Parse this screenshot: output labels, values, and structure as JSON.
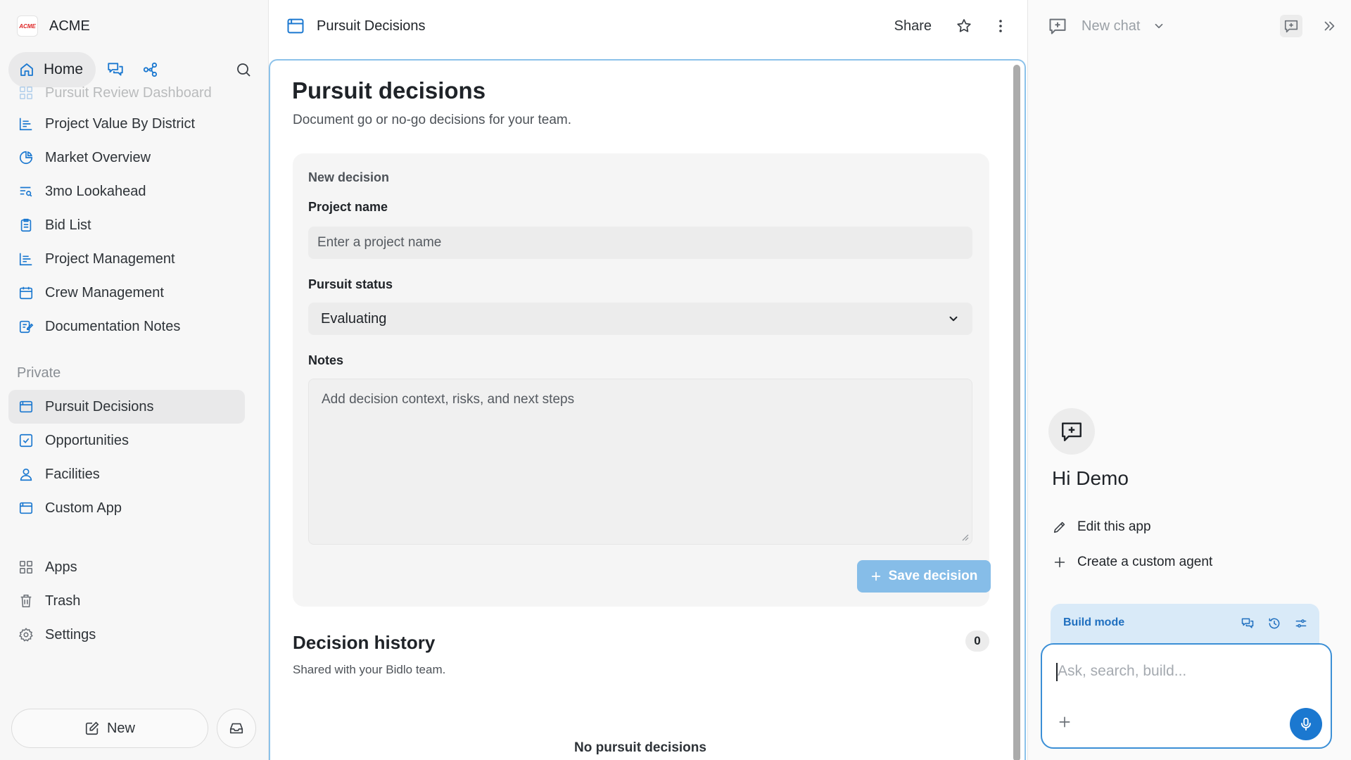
{
  "sidebar": {
    "brand": {
      "logo_text": "ACME",
      "name": "ACME"
    },
    "home_label": "Home",
    "items": [
      {
        "label": "Pursuit Review Dashboard",
        "icon": "dashboard-icon"
      },
      {
        "label": "Project Value By District",
        "icon": "bar-chart-icon"
      },
      {
        "label": "Market Overview",
        "icon": "pie-chart-icon"
      },
      {
        "label": "3mo Lookahead",
        "icon": "list-search-icon"
      },
      {
        "label": "Bid List",
        "icon": "clipboard-icon"
      },
      {
        "label": "Project Management",
        "icon": "bar-chart-icon"
      },
      {
        "label": "Crew Management",
        "icon": "calendar-icon"
      },
      {
        "label": "Documentation Notes",
        "icon": "edit-note-icon"
      }
    ],
    "private_label": "Private",
    "private_items": [
      {
        "label": "Pursuit Decisions",
        "icon": "app-window-icon",
        "active": true
      },
      {
        "label": "Opportunities",
        "icon": "checkbox-icon"
      },
      {
        "label": "Facilities",
        "icon": "person-icon"
      },
      {
        "label": "Custom App",
        "icon": "app-window-icon"
      }
    ],
    "utility_items": [
      {
        "label": "Apps",
        "icon": "grid-icon"
      },
      {
        "label": "Trash",
        "icon": "trash-icon"
      },
      {
        "label": "Settings",
        "icon": "gear-icon"
      }
    ],
    "new_label": "New"
  },
  "main": {
    "doc_title": "Pursuit Decisions",
    "share_label": "Share",
    "page_title": "Pursuit decisions",
    "page_subtitle": "Document go or no-go decisions for your team.",
    "form": {
      "heading": "New decision",
      "project_name_label": "Project name",
      "project_name_placeholder": "Enter a project name",
      "status_label": "Pursuit status",
      "status_value": "Evaluating",
      "notes_label": "Notes",
      "notes_placeholder": "Add decision context, risks, and next steps",
      "save_label": "Save decision"
    },
    "history": {
      "title": "Decision history",
      "count": "0",
      "subtitle": "Shared with your Bidlo team.",
      "empty_text": "No pursuit decisions"
    }
  },
  "chat": {
    "new_chat_label": "New chat",
    "greeting": "Hi Demo",
    "actions": [
      {
        "label": "Edit this app",
        "icon": "pencil-icon"
      },
      {
        "label": "Create a custom agent",
        "icon": "plus-icon"
      }
    ],
    "build_mode_label": "Build mode",
    "input_placeholder": "Ask, search, build..."
  },
  "colors": {
    "accent": "#1b78d0",
    "accent_light": "#86bde8",
    "frame_border": "#8cc2ea",
    "build_bar_bg": "#d9eaf8"
  }
}
